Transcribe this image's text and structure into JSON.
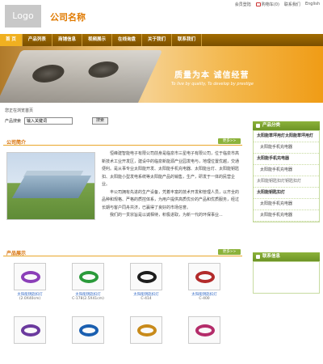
{
  "header": {
    "logo": "Logo",
    "company": "公司名称",
    "links": {
      "member": "会员登陆",
      "cart": "购物车",
      "cart_count": "(0)",
      "contact": "联系我们",
      "english": "English"
    }
  },
  "nav": [
    "首 页",
    "产品列表",
    "商铺信息",
    "视频展示",
    "在线询盘",
    "关于我们",
    "联系我们"
  ],
  "banner": {
    "title": "质量为本  诚信经营",
    "subtitle": "To live by quality, To develop by prestige"
  },
  "breadcrumb": "您正在浏览首页",
  "search": {
    "label": "产品搜索",
    "placeholder": "输入关键词",
    "button": "搜索"
  },
  "intro": {
    "heading": "公司简介",
    "more": "更多>>",
    "paragraphs": [
      "恒峰建智能电子有限公司前身是临泉市三星电子有限公司，位于临泉市高新技术工业开发区，建设中的临泉新能源产业园发电与，地理位置优越，交通便利。是从事专业太阳能开发、太阳能手机充电器、太阳能台灯、太阳能钥匙扣、太阳能小型发电系统等太阳能产品的销售，生产，研发于一体的民营企业。",
      "丰公司拥有先进的生产设备，凭着丰富的技术开发和管理人员，以齐全的品种和规格、严格的质控体系，为用户提供高质优价的产品和优质服务，经过长期与客户同舟共济，已赢得了良好的市场信誉。",
      "我们的一贯宗旨是以诚相待，积极进取，为新一代的环保事业..."
    ]
  },
  "products": {
    "heading": "产品展示",
    "more": "更多>>",
    "items": [
      {
        "name": "太阳能钥匙扣灯",
        "code": "(2.0X40cm)",
        "color": "#8b3fb8"
      },
      {
        "name": "太阳能钥匙扣灯",
        "code": "C-178(2.5X41cm)",
        "color": "#2a9a3a"
      },
      {
        "name": "太阳能钥匙扣灯",
        "code": "C-414",
        "color": "#1d1d1d"
      },
      {
        "name": "太阳能钥匙扣灯",
        "code": "C-400",
        "color": "#b22a2a"
      },
      {
        "name": "",
        "code": "",
        "color": "#6b3a9e"
      },
      {
        "name": "",
        "code": "",
        "color": "#1a5fb0"
      },
      {
        "name": "",
        "code": "",
        "color": "#c88a1a"
      },
      {
        "name": "",
        "code": "",
        "color": "#b42c6a"
      }
    ]
  },
  "sidebar": {
    "category_title": "产品分类",
    "categories": [
      {
        "label": "太阳能草坪用灯太阳能草坪用灯",
        "style": "bold"
      },
      {
        "label": "太阳能手机充电器",
        "style": "sub"
      },
      {
        "label": "太阳能手机充电器",
        "style": "bold"
      },
      {
        "label": "太阳能手机充电器",
        "style": "sub"
      },
      {
        "label": "太阳能钥匙扣灯钥匙扣灯",
        "style": "plain"
      },
      {
        "label": "太阳能钥匙扣灯",
        "style": "bold"
      },
      {
        "label": "太阳能手机充电器",
        "style": "sub"
      },
      {
        "label": "太阳能手机充电器",
        "style": "sub"
      }
    ],
    "contact_title": "联系信息"
  },
  "colors": {
    "accent": "#e07a00",
    "nav": "#8a5a00",
    "green": "#8cb23b"
  }
}
